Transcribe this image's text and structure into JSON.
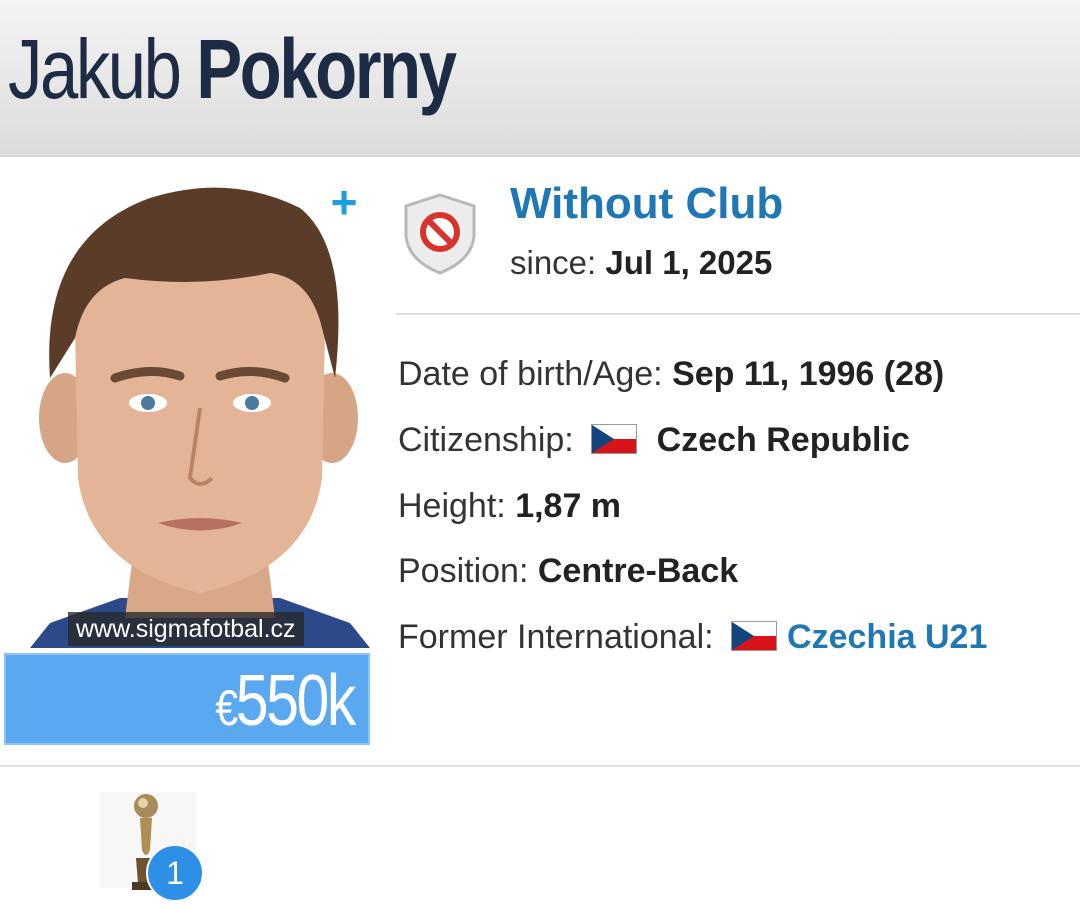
{
  "player": {
    "first_name": "Jakub",
    "last_name": "Pokorny"
  },
  "photo": {
    "credit": "www.sigmafotbal.cz",
    "add_icon": "plus-icon",
    "plus_label": "+"
  },
  "market_value": {
    "currency": "€",
    "amount": "550k"
  },
  "club": {
    "name": "Without Club",
    "since_label": "since:",
    "since_date": "Jul 1, 2025",
    "crest_icon": "no-club-shield-icon"
  },
  "info": {
    "dob_label": "Date of birth/Age:",
    "dob_value": "Sep 11, 1996 (28)",
    "citizenship_label": "Citizenship:",
    "citizenship_value": "Czech Republic",
    "height_label": "Height:",
    "height_value": "1,87 m",
    "position_label": "Position:",
    "position_value": "Centre-Back",
    "former_int_label": "Former International:",
    "former_int_value": "Czechia U21"
  },
  "trophies": {
    "icon": "trophy-icon",
    "count": "1"
  },
  "colors": {
    "link_blue": "#1f77b4",
    "value_box": "#5aa8f0",
    "name_navy": "#1d2b44",
    "plus_blue": "#1a9fe0"
  }
}
